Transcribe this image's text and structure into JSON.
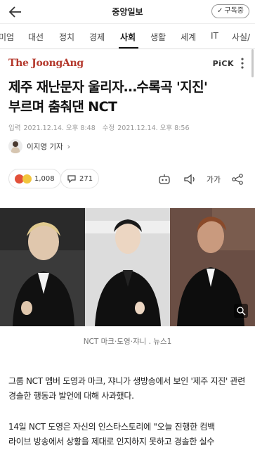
{
  "topbar": {
    "title": "중앙일보",
    "subscribe_label": "구독중"
  },
  "nav": {
    "items": [
      "미엄",
      "대선",
      "정치",
      "경제",
      "사회",
      "생활",
      "세계",
      "IT",
      "사실/"
    ],
    "active": "사회"
  },
  "article": {
    "brand": "The JoongAng",
    "pick": "PiCK",
    "headline_line1": "제주 재난문자 울리자…수록곡 '지진'",
    "headline_line2": "부르며 춤춰댄 NCT",
    "input_label": "입력",
    "input_date": "2021.12.14. 오후 8:48",
    "edit_label": "수정",
    "edit_date": "2021.12.14. 오후 8:56",
    "reporter": "이지영 기자",
    "reaction_count": "1,008",
    "comment_count": "271",
    "font_size_label": "가가",
    "photo_caption": "NCT 마크·도영·쟈니 . 뉴스1",
    "paragraph1": "그룹 NCT 멤버 도영과 마크, 쟈니가 생방송에서 보인 '제주 지진' 관련 경솔한 행동과 발언에 대해 사과했다.",
    "paragraph2_line1": "14일 NCT 도영은 자신의 인스타스토리에 \"오늘 진행한 컴백",
    "paragraph2_line2": "라이브 방송에서 상황을 제대로 인지하지 못하고 경솔한 실수"
  },
  "colors": {
    "brand": "#b4382c",
    "reaction_red": "#e2503a",
    "reaction_yellow": "#f2c53d"
  }
}
